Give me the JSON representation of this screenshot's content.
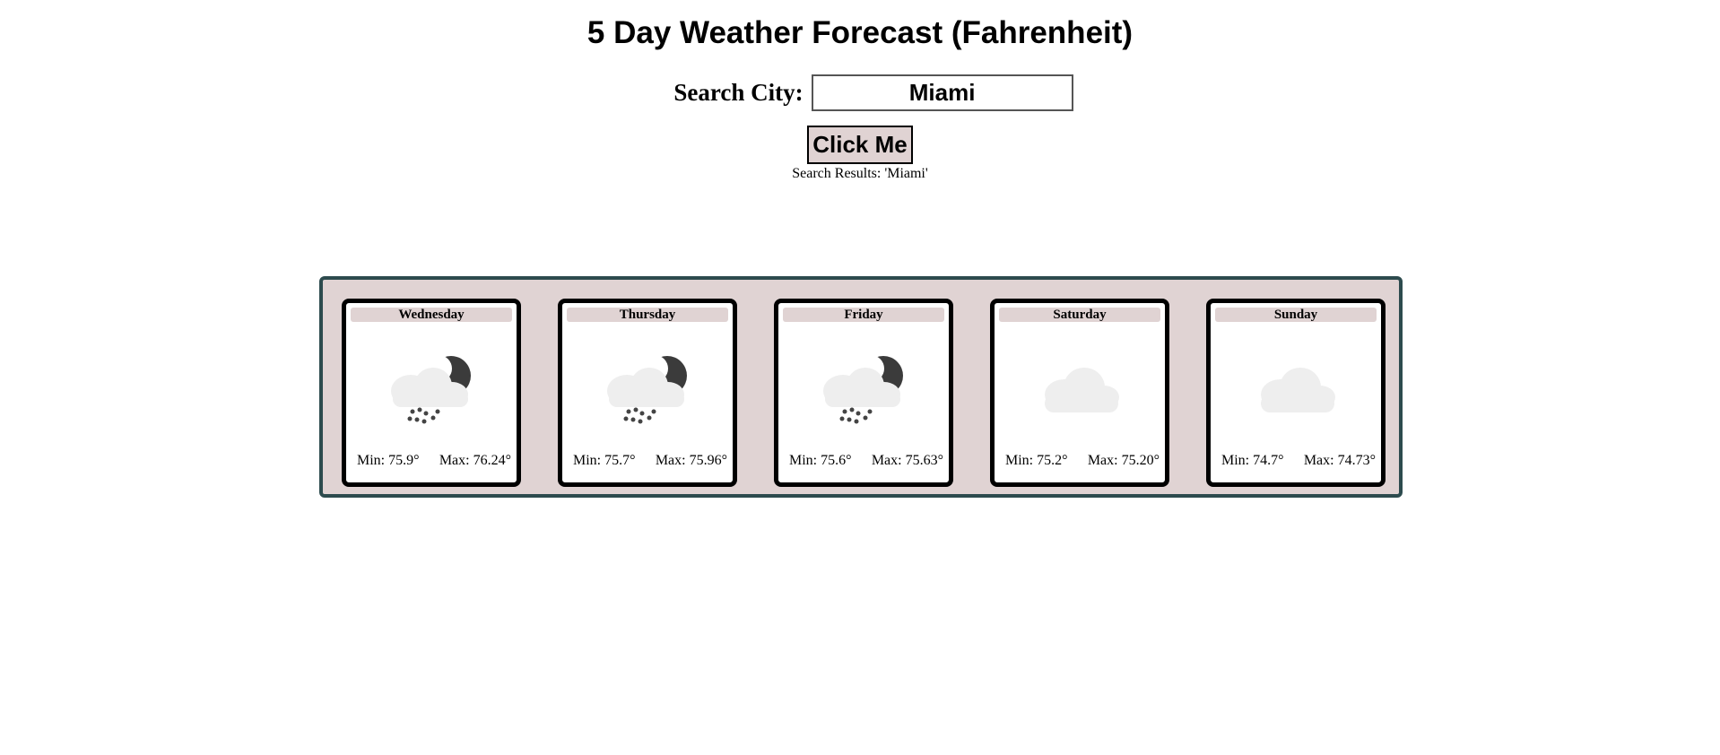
{
  "header": {
    "title": "5 Day Weather Forecast (Fahrenheit)"
  },
  "search": {
    "label": "Search City:",
    "value": "Miami",
    "button_label": "Click Me",
    "results_text": "Search Results: 'Miami'"
  },
  "forecast": {
    "days": [
      {
        "day": "Wednesday",
        "icon": "snow-night-icon",
        "min": "Min: 75.9°",
        "max": "Max: 76.24°"
      },
      {
        "day": "Thursday",
        "icon": "snow-night-icon",
        "min": "Min: 75.7°",
        "max": "Max: 75.96°"
      },
      {
        "day": "Friday",
        "icon": "snow-night-icon",
        "min": "Min: 75.6°",
        "max": "Max: 75.63°"
      },
      {
        "day": "Saturday",
        "icon": "cloud-icon",
        "min": "Min: 75.2°",
        "max": "Max: 75.20°"
      },
      {
        "day": "Sunday",
        "icon": "cloud-icon",
        "min": "Min: 74.7°",
        "max": "Max: 74.73°"
      }
    ]
  },
  "colors": {
    "panel_background": "#e0d3d3",
    "panel_border": "#2d4b4e",
    "button_background": "#e0d3d3"
  }
}
